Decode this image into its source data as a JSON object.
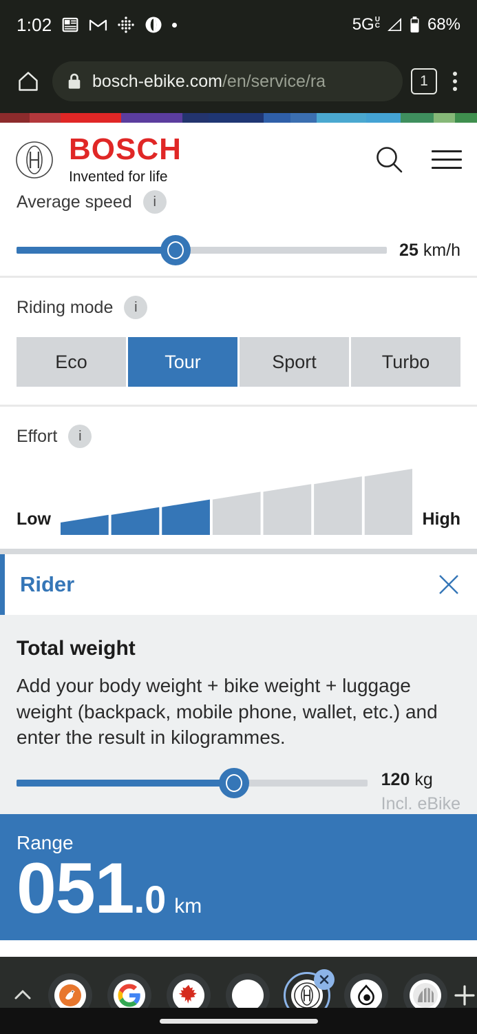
{
  "status_bar": {
    "clock": "1:02",
    "icons": [
      "calendar-icon",
      "gmail-icon",
      "dots-grid-icon",
      "opera-icon",
      "dot-icon"
    ],
    "network": "5G",
    "network_sub_top": "U",
    "network_sub_bottom": "C",
    "battery_percent": "68%"
  },
  "browser": {
    "home_icon": "home-icon",
    "lock_icon": "lock-icon",
    "url_host": "bosch-ebike.com",
    "url_path": "/en/service/ra",
    "url_full": "bosch-ebike.com/en/service/ra",
    "tab_count": "1",
    "menu_icon": "kebab-menu-icon"
  },
  "stripe": [
    {
      "color": "#8c2b2c",
      "width": 12.3
    },
    {
      "color": "#b3383c",
      "width": 13.0
    },
    {
      "color": "#e02726",
      "width": 25.5
    },
    {
      "color": "#5b3d9e",
      "width": 25.8
    },
    {
      "color": "#23346e",
      "width": 10.8
    },
    {
      "color": "#1f3673",
      "width": 23.0
    },
    {
      "color": "#2f5fa8",
      "width": 11.5
    },
    {
      "color": "#3b6fb0",
      "width": 11.0
    },
    {
      "color": "#4aa8d0",
      "width": 20.5
    },
    {
      "color": "#44a3d4",
      "width": 14.5
    },
    {
      "color": "#3f8f5e",
      "width": 14.0
    },
    {
      "color": "#86b878",
      "width": 9.0
    },
    {
      "color": "#3f8f4e",
      "width": 9.1
    }
  ],
  "site_header": {
    "logo_icon": "bosch-logo-icon",
    "brand": "BOSCH",
    "tagline": "Invented for life",
    "search_icon": "search-icon",
    "menu_icon": "hamburger-menu-icon"
  },
  "calculator": {
    "average_speed": {
      "label": "Average speed",
      "info_icon": "info-icon",
      "value": "25",
      "unit": "km/h",
      "fill_percent": 43
    },
    "riding_mode": {
      "label": "Riding mode",
      "info_icon": "info-icon",
      "options": [
        "Eco",
        "Tour",
        "Sport",
        "Turbo"
      ],
      "selected": "Tour"
    },
    "effort": {
      "label": "Effort",
      "info_icon": "info-icon",
      "low_label": "Low",
      "high_label": "High",
      "segments": 7,
      "filled": 3,
      "fill_color": "#3576b7",
      "empty_color": "#d3d6d9"
    },
    "rider": {
      "title": "Rider",
      "close_icon": "close-icon",
      "heading": "Total weight",
      "description": "Add your body weight + bike weight + luggage weight (backpack, mobile phone, wallet, etc.) and enter the result in kilogrammes.",
      "weight_value": "120",
      "weight_unit": "kg",
      "weight_note": "Incl. eBike",
      "fill_percent": 62
    },
    "range": {
      "label": "Range",
      "integer": "051",
      "decimal": ".0",
      "unit": "km",
      "background": "#3576b7"
    }
  },
  "tabstrip": {
    "expand_icon": "chevron-up-icon",
    "tabs": [
      {
        "name": "duckduckgo-favicon",
        "kind": "duck",
        "active": false
      },
      {
        "name": "google-favicon",
        "kind": "google",
        "active": false
      },
      {
        "name": "canada-favicon",
        "kind": "maple-leaf",
        "active": false
      },
      {
        "name": "blank-favicon",
        "kind": "blank",
        "active": false
      },
      {
        "name": "bosch-favicon",
        "kind": "bosch",
        "active": true
      },
      {
        "name": "droplet-favicon",
        "kind": "droplet",
        "active": false
      },
      {
        "name": "striped-favicon",
        "kind": "striped",
        "active": false
      }
    ],
    "new_tab_icon": "plus-icon"
  }
}
